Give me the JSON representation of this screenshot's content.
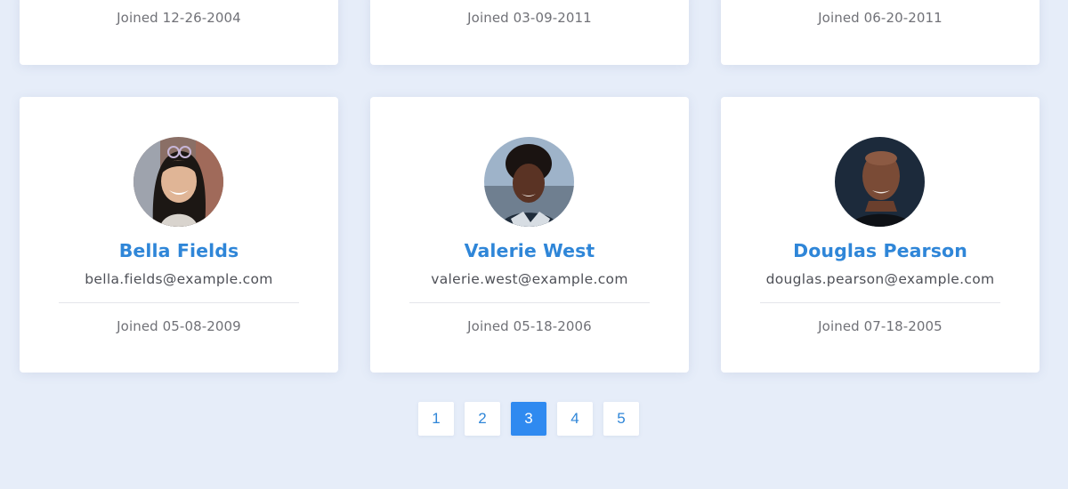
{
  "colors": {
    "background": "#e6edf9",
    "accent": "#2f86d8",
    "active_page": "#2f8af0"
  },
  "top_row": [
    {
      "joined": "Joined 12-26-2004"
    },
    {
      "joined": "Joined 03-09-2011"
    },
    {
      "joined": "Joined 06-20-2011"
    }
  ],
  "users": [
    {
      "name": "Bella Fields",
      "email": "bella.fields@example.com",
      "joined": "Joined 05-08-2009",
      "avatar": "avatar-photo"
    },
    {
      "name": "Valerie West",
      "email": "valerie.west@example.com",
      "joined": "Joined 05-18-2006",
      "avatar": "avatar-photo"
    },
    {
      "name": "Douglas Pearson",
      "email": "douglas.pearson@example.com",
      "joined": "Joined 07-18-2005",
      "avatar": "avatar-photo"
    }
  ],
  "pagination": {
    "pages": [
      "1",
      "2",
      "3",
      "4",
      "5"
    ],
    "current": "3"
  }
}
